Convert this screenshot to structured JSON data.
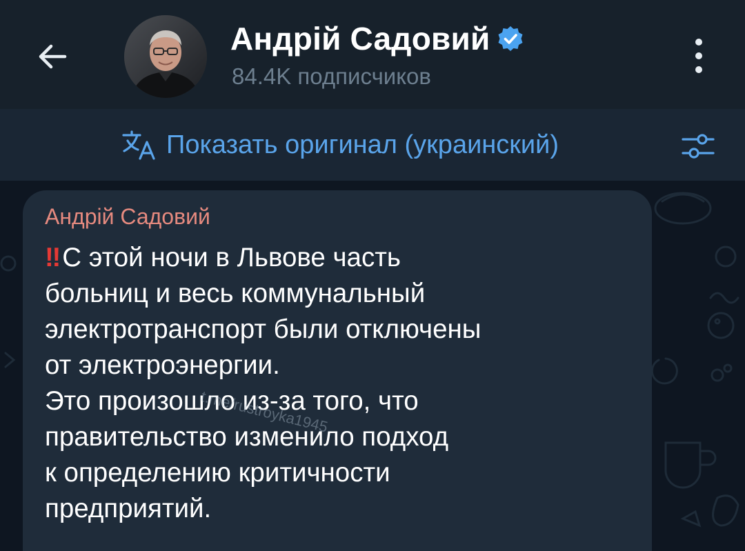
{
  "header": {
    "channel_name": "Андрій Садовий",
    "subscribers": "84.4K подписчиков",
    "back_icon": "arrow-left-icon",
    "verified_icon": "verified-badge-icon",
    "menu_icon": "more-vertical-icon"
  },
  "translate_bar": {
    "show_original_label": "Показать оригинал (украинский)",
    "translate_icon": "translate-icon",
    "settings_icon": "sliders-icon",
    "link_color": "#5aa4ea"
  },
  "message": {
    "author": "Андрій Садовий",
    "author_color": "#e68a7f",
    "emoji": "‼",
    "text": "С этой ночи в Львове часть\nбольниц и весь коммунальный\nэлектротранспорт были отключены\nот электроэнергии.\nЭто произошло из-за того, что\nправительство изменило подход\nк определению критичности\nпредприятий.",
    "watermark": "t.me/rustroyka1945"
  },
  "colors": {
    "header_bg": "#17212b",
    "chat_bg": "#0e1621",
    "bubble_bg": "#1f2c3a"
  }
}
